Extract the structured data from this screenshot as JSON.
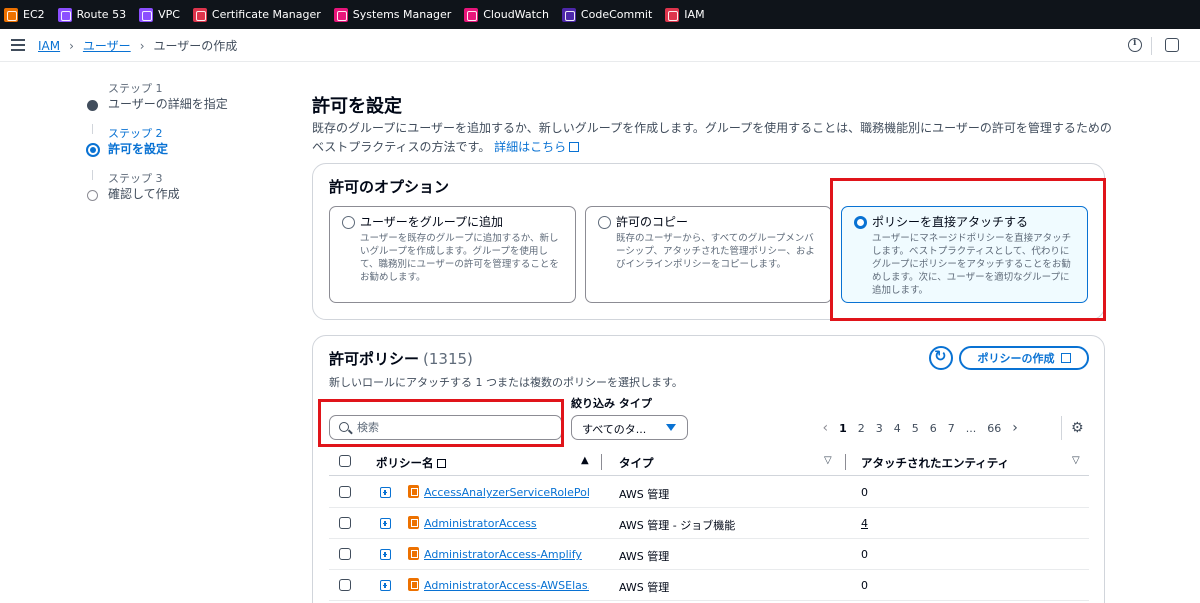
{
  "services": [
    {
      "label": "EC2",
      "icon": "ec2-icon",
      "color": "#ed7100"
    },
    {
      "label": "Route 53",
      "icon": "route53-icon",
      "color": "#8c4fff"
    },
    {
      "label": "VPC",
      "icon": "vpc-icon",
      "color": "#8c4fff"
    },
    {
      "label": "Certificate Manager",
      "icon": "certificate-manager-icon",
      "color": "#dd344c"
    },
    {
      "label": "Systems Manager",
      "icon": "systems-manager-icon",
      "color": "#e7157b"
    },
    {
      "label": "CloudWatch",
      "icon": "cloudwatch-icon",
      "color": "#e7157b"
    },
    {
      "label": "CodeCommit",
      "icon": "codecommit-icon",
      "color": "#4d27aa"
    },
    {
      "label": "IAM",
      "icon": "iam-icon",
      "color": "#dd344c"
    }
  ],
  "breadcrumb": {
    "root": "IAM",
    "users": "ユーザー",
    "current": "ユーザーの作成"
  },
  "steps": [
    {
      "label": "ステップ 1",
      "name": "ユーザーの詳細を指定",
      "state": "done"
    },
    {
      "label": "ステップ 2",
      "name": "許可を設定",
      "state": "active"
    },
    {
      "label": "ステップ 3",
      "name": "確認して作成",
      "state": "pending"
    }
  ],
  "page": {
    "title": "許可を設定",
    "description": "既存のグループにユーザーを追加するか、新しいグループを作成します。グループを使用することは、職務機能別にユーザーの許可を管理するためのベストプラクティスの方法です。",
    "learn_more": "詳細はこちら"
  },
  "options": {
    "title": "許可のオプション",
    "tiles": [
      {
        "title": "ユーザーをグループに追加",
        "description": "ユーザーを既存のグループに追加するか、新しいグループを作成します。グループを使用して、職務別にユーザーの許可を管理することをお勧めします。",
        "selected": false
      },
      {
        "title": "許可のコピー",
        "description": "既存のユーザーから、すべてのグループメンバーシップ、アタッチされた管理ポリシー、およびインラインポリシーをコピーします。",
        "selected": false
      },
      {
        "title": "ポリシーを直接アタッチする",
        "description": "ユーザーにマネージドポリシーを直接アタッチします。ベストプラクティスとして、代わりにグループにポリシーをアタッチすることをお勧めします。次に、ユーザーを適切なグループに追加します。",
        "selected": true
      }
    ]
  },
  "policies": {
    "title": "許可ポリシー",
    "count": "(1315)",
    "description": "新しいロールにアタッチする 1 つまたは複数のポリシーを選択します。",
    "create_button": "ポリシーの作成",
    "filter_label": "絞り込み タイプ",
    "search_placeholder": "検索",
    "filter_value": "すべてのタ...",
    "pages": [
      "1",
      "2",
      "3",
      "4",
      "5",
      "6",
      "7",
      "...",
      "66"
    ],
    "current_page": "1",
    "columns": {
      "name": "ポリシー名",
      "type": "タイプ",
      "entities": "アタッチされたエンティティ"
    },
    "rows": [
      {
        "name": "AccessAnalyzerServiceRolePol...",
        "type": "AWS 管理",
        "entities": "0"
      },
      {
        "name": "AdministratorAccess",
        "type": "AWS 管理 - ジョブ機能",
        "entities": "4"
      },
      {
        "name": "AdministratorAccess-Amplify",
        "type": "AWS 管理",
        "entities": "0"
      },
      {
        "name": "AdministratorAccess-AWSElas...",
        "type": "AWS 管理",
        "entities": "0"
      }
    ]
  }
}
